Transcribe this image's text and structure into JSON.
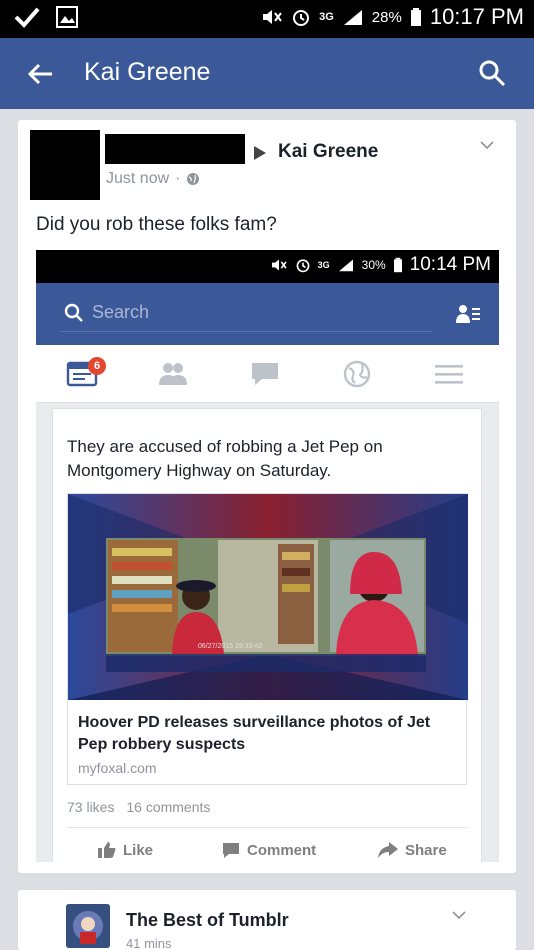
{
  "status_bar": {
    "battery": "28%",
    "network": "3G",
    "time": "10:17 PM"
  },
  "app_bar": {
    "title": "Kai Greene"
  },
  "post": {
    "target_name": "Kai Greene",
    "timestamp": "Just now",
    "text": "Did you rob these folks fam?"
  },
  "inner_screenshot": {
    "status_bar": {
      "battery": "30%",
      "network": "3G",
      "time": "10:14 PM"
    },
    "search_placeholder": "Search",
    "notifications_badge": "6",
    "story_text": "They are accused of robbing a Jet Pep on Montgomery Highway on Saturday.",
    "link_title": "Hoover PD releases surveillance photos of Jet Pep robbery suspects",
    "link_domain": "myfoxal.com",
    "likes": "73 likes",
    "comments": "16 comments",
    "photo_timestamp": "06/27/2015 19:33:42",
    "actions": {
      "like": "Like",
      "comment": "Comment",
      "share": "Share"
    }
  },
  "next_post": {
    "name": "The Best of Tumblr",
    "timestamp": "41 mins"
  },
  "colors": {
    "brand": "#3b5998",
    "background": "#dcdee3"
  }
}
